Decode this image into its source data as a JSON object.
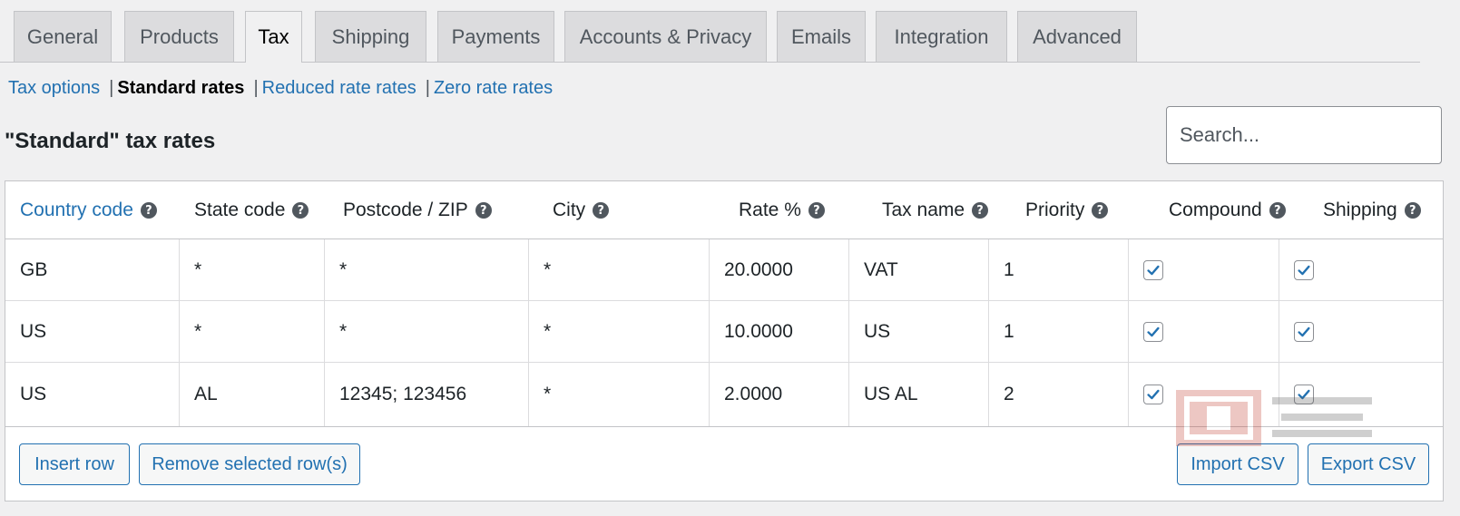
{
  "tabs": [
    {
      "label": "General",
      "active": false
    },
    {
      "label": "Products",
      "active": false
    },
    {
      "label": "Tax",
      "active": true
    },
    {
      "label": "Shipping",
      "active": false
    },
    {
      "label": "Payments",
      "active": false
    },
    {
      "label": "Accounts & Privacy",
      "active": false
    },
    {
      "label": "Emails",
      "active": false
    },
    {
      "label": "Integration",
      "active": false
    },
    {
      "label": "Advanced",
      "active": false
    }
  ],
  "subnav": {
    "tax_options": "Tax options",
    "standard_rates": "Standard rates",
    "reduced_rates": "Reduced rate rates",
    "zero_rates": "Zero rate rates",
    "separator": "|"
  },
  "heading": "\"Standard\" tax rates",
  "search": {
    "placeholder": "Search...",
    "value": ""
  },
  "help_glyph": "?",
  "columns": {
    "country": "Country code",
    "state": "State code",
    "postcode": "Postcode / ZIP",
    "city": "City",
    "rate": "Rate %",
    "tax_name": "Tax name",
    "priority": "Priority",
    "compound": "Compound",
    "shipping": "Shipping"
  },
  "rows": [
    {
      "country": "GB",
      "state": "*",
      "postcode": "*",
      "city": "*",
      "rate": "20.0000",
      "tax_name": "VAT",
      "priority": "1",
      "compound": true,
      "shipping": true
    },
    {
      "country": "US",
      "state": "*",
      "postcode": "*",
      "city": "*",
      "rate": "10.0000",
      "tax_name": "US",
      "priority": "1",
      "compound": true,
      "shipping": true
    },
    {
      "country": "US",
      "state": "AL",
      "postcode": "12345; 123456",
      "city": "*",
      "rate": "2.0000",
      "tax_name": "US AL",
      "priority": "2",
      "compound": true,
      "shipping": true
    }
  ],
  "buttons": {
    "insert_row": "Insert row",
    "remove_rows": "Remove selected row(s)",
    "import_csv": "Import CSV",
    "export_csv": "Export CSV"
  },
  "colors": {
    "link": "#2271b1",
    "tab_bg": "#dcdcde",
    "page_bg": "#f0f0f1",
    "checkmark": "#2271b1"
  }
}
